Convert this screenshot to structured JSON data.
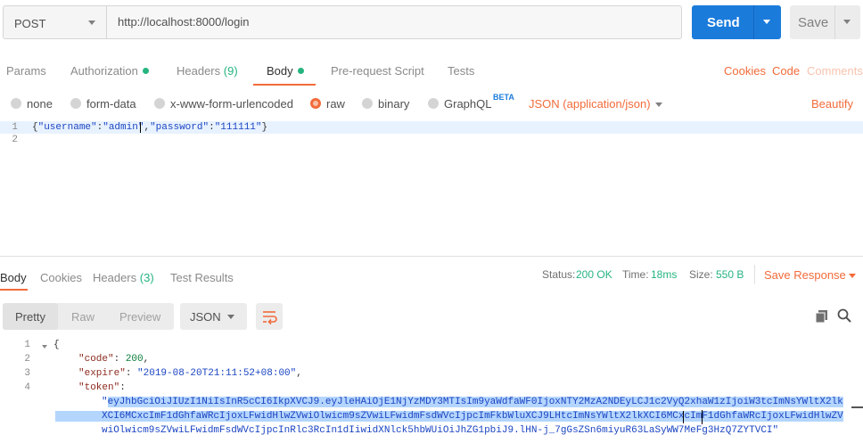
{
  "request": {
    "method": "POST",
    "url": "http://localhost:8000/login",
    "send_label": "Send",
    "save_label": "Save"
  },
  "request_tabs": {
    "params": "Params",
    "authorization": "Authorization",
    "headers": "Headers",
    "headers_count": "(9)",
    "body": "Body",
    "pre_request_script": "Pre-request Script",
    "tests": "Tests",
    "cookies": "Cookies",
    "code": "Code",
    "comments": "Comments"
  },
  "body_types": {
    "none": "none",
    "form_data": "form-data",
    "urlencoded": "x-www-form-urlencoded",
    "raw": "raw",
    "binary": "binary",
    "graphql": "GraphQL",
    "beta": "BETA",
    "content_type": "JSON (application/json)",
    "beautify": "Beautify"
  },
  "request_body": {
    "line_numbers": [
      "1",
      "2"
    ],
    "open": "{",
    "k1": "\"username\"",
    "colon1": ":",
    "v1": "\"admin\"",
    "comma": ",",
    "k2": "\"password\"",
    "colon2": ":",
    "v2": "\"111111\"",
    "close": "}"
  },
  "response_tabs": {
    "body": "Body",
    "cookies": "Cookies",
    "headers": "Headers",
    "headers_count": "(3)",
    "test_results": "Test Results"
  },
  "response_status": {
    "status_label": "Status:",
    "status_value": "200 OK",
    "time_label": "Time:",
    "time_value": "18ms",
    "size_label": "Size:",
    "size_value": "550 B",
    "save_response": "Save Response"
  },
  "response_view": {
    "pretty": "Pretty",
    "raw": "Raw",
    "preview": "Preview",
    "format": "JSON"
  },
  "response_body": {
    "line_numbers": [
      "1",
      "2",
      "3",
      "4"
    ],
    "open": "{",
    "code_key": "\"code\"",
    "code_val": "200",
    "expire_key": "\"expire\"",
    "expire_val": "\"2019-08-20T21:11:52+08:00\"",
    "token_key": "\"token\"",
    "token_quote": "\"",
    "token_line1": "eyJhbGciOiJIUzI1NiIsInR5cCI6IkpXVCJ9.eyJleHAiOjE1NjYzMDY3MTIsIm9yaWdfaWF0IjoxNTY2MzA2NDEyLCJ1c2VyQ2xhaW1zIjoiW3tcImNsYWltX2lk",
    "token_line2": "XCI6MCxcImF1dGhfaWRcIjoxLFwidHlwZVwiOlwicm9sZVwiLFwidmFsdWVcIjpcImFkbWluXCJ9LHtcImNsYWltX2lkXCI6MCxcImF1dGhfaWRcIjoxLFwidHlwZV",
    "token_line3": "wiOlwicm9sZVwiLFwidmFsdWVcIjpcInRlc3RcIn1dIiwidXNlck5hbWUiOiJhZG1pbiJ9.lHN-j_7gGsZSn6miyuR63LaSyWW7MeFg3HzQ7ZYTVCI\""
  }
}
